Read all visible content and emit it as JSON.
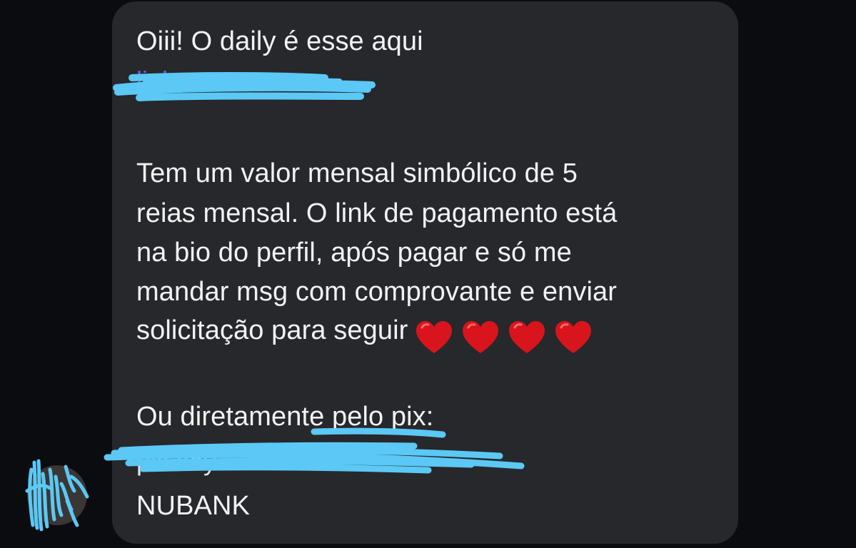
{
  "message": {
    "line1": "Oiii! O daily é esse aqui",
    "line2": "Tem um valor mensal simbólico de 5",
    "line3": "reias mensal. O link de pagamento está",
    "line4": "na bio do perfil, após pagar e só me",
    "line5": "mandar msg com comprovante e enviar",
    "line6": "solicitação para seguir",
    "line7": "Ou diretamente pelo pix:",
    "line8": "NUBANK",
    "heart_count": 4,
    "heart_icon": "red-heart-emoji"
  },
  "colors": {
    "bubble": "#26282c",
    "background": "#0b0c0f",
    "text": "#f2f2f4",
    "redaction": "#5bc8f5",
    "heart": "#d8141c"
  }
}
